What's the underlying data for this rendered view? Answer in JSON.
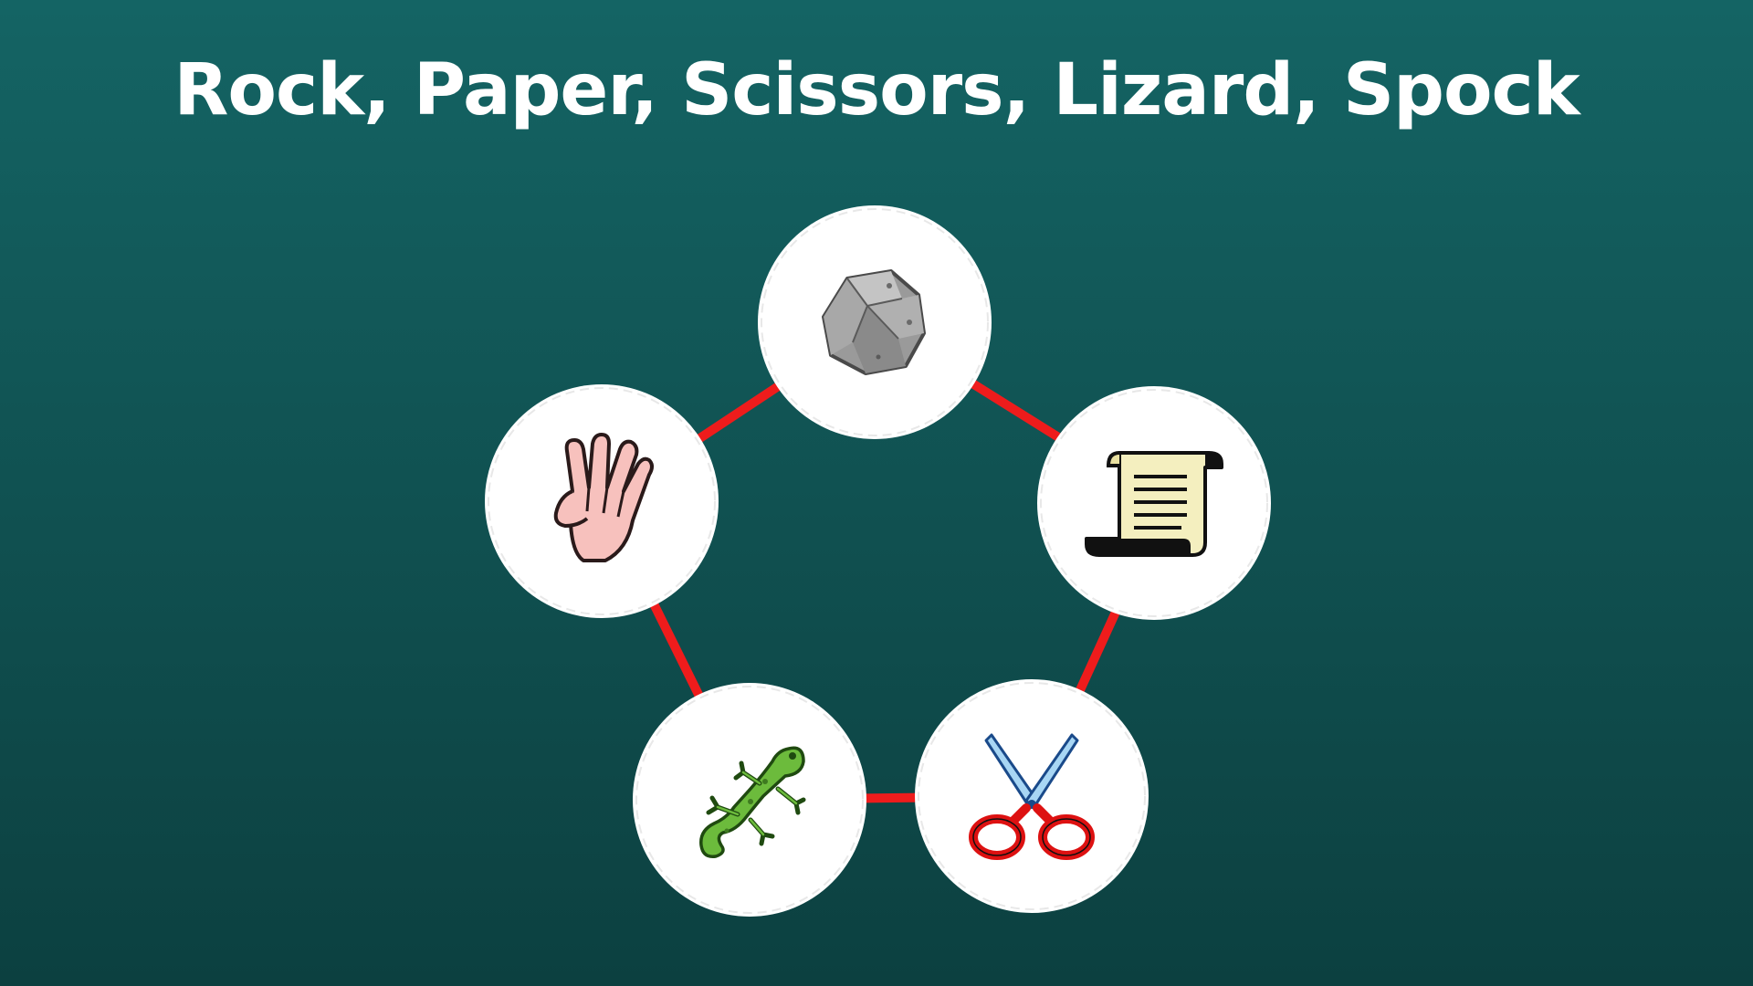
{
  "title": "Rock, Paper, Scissors, Lizard, Spock",
  "colors": {
    "background_top": "#146464",
    "background_bottom": "#0c4040",
    "edge": "#ee1c1c",
    "token_fill": "#ffffff",
    "title_text": "#ffffff"
  },
  "choices": [
    {
      "id": "rock",
      "icon": "rock-icon"
    },
    {
      "id": "paper",
      "icon": "paper-scroll-icon"
    },
    {
      "id": "scissors",
      "icon": "scissors-icon"
    },
    {
      "id": "lizard",
      "icon": "lizard-icon"
    },
    {
      "id": "spock",
      "icon": "vulcan-salute-icon"
    }
  ]
}
